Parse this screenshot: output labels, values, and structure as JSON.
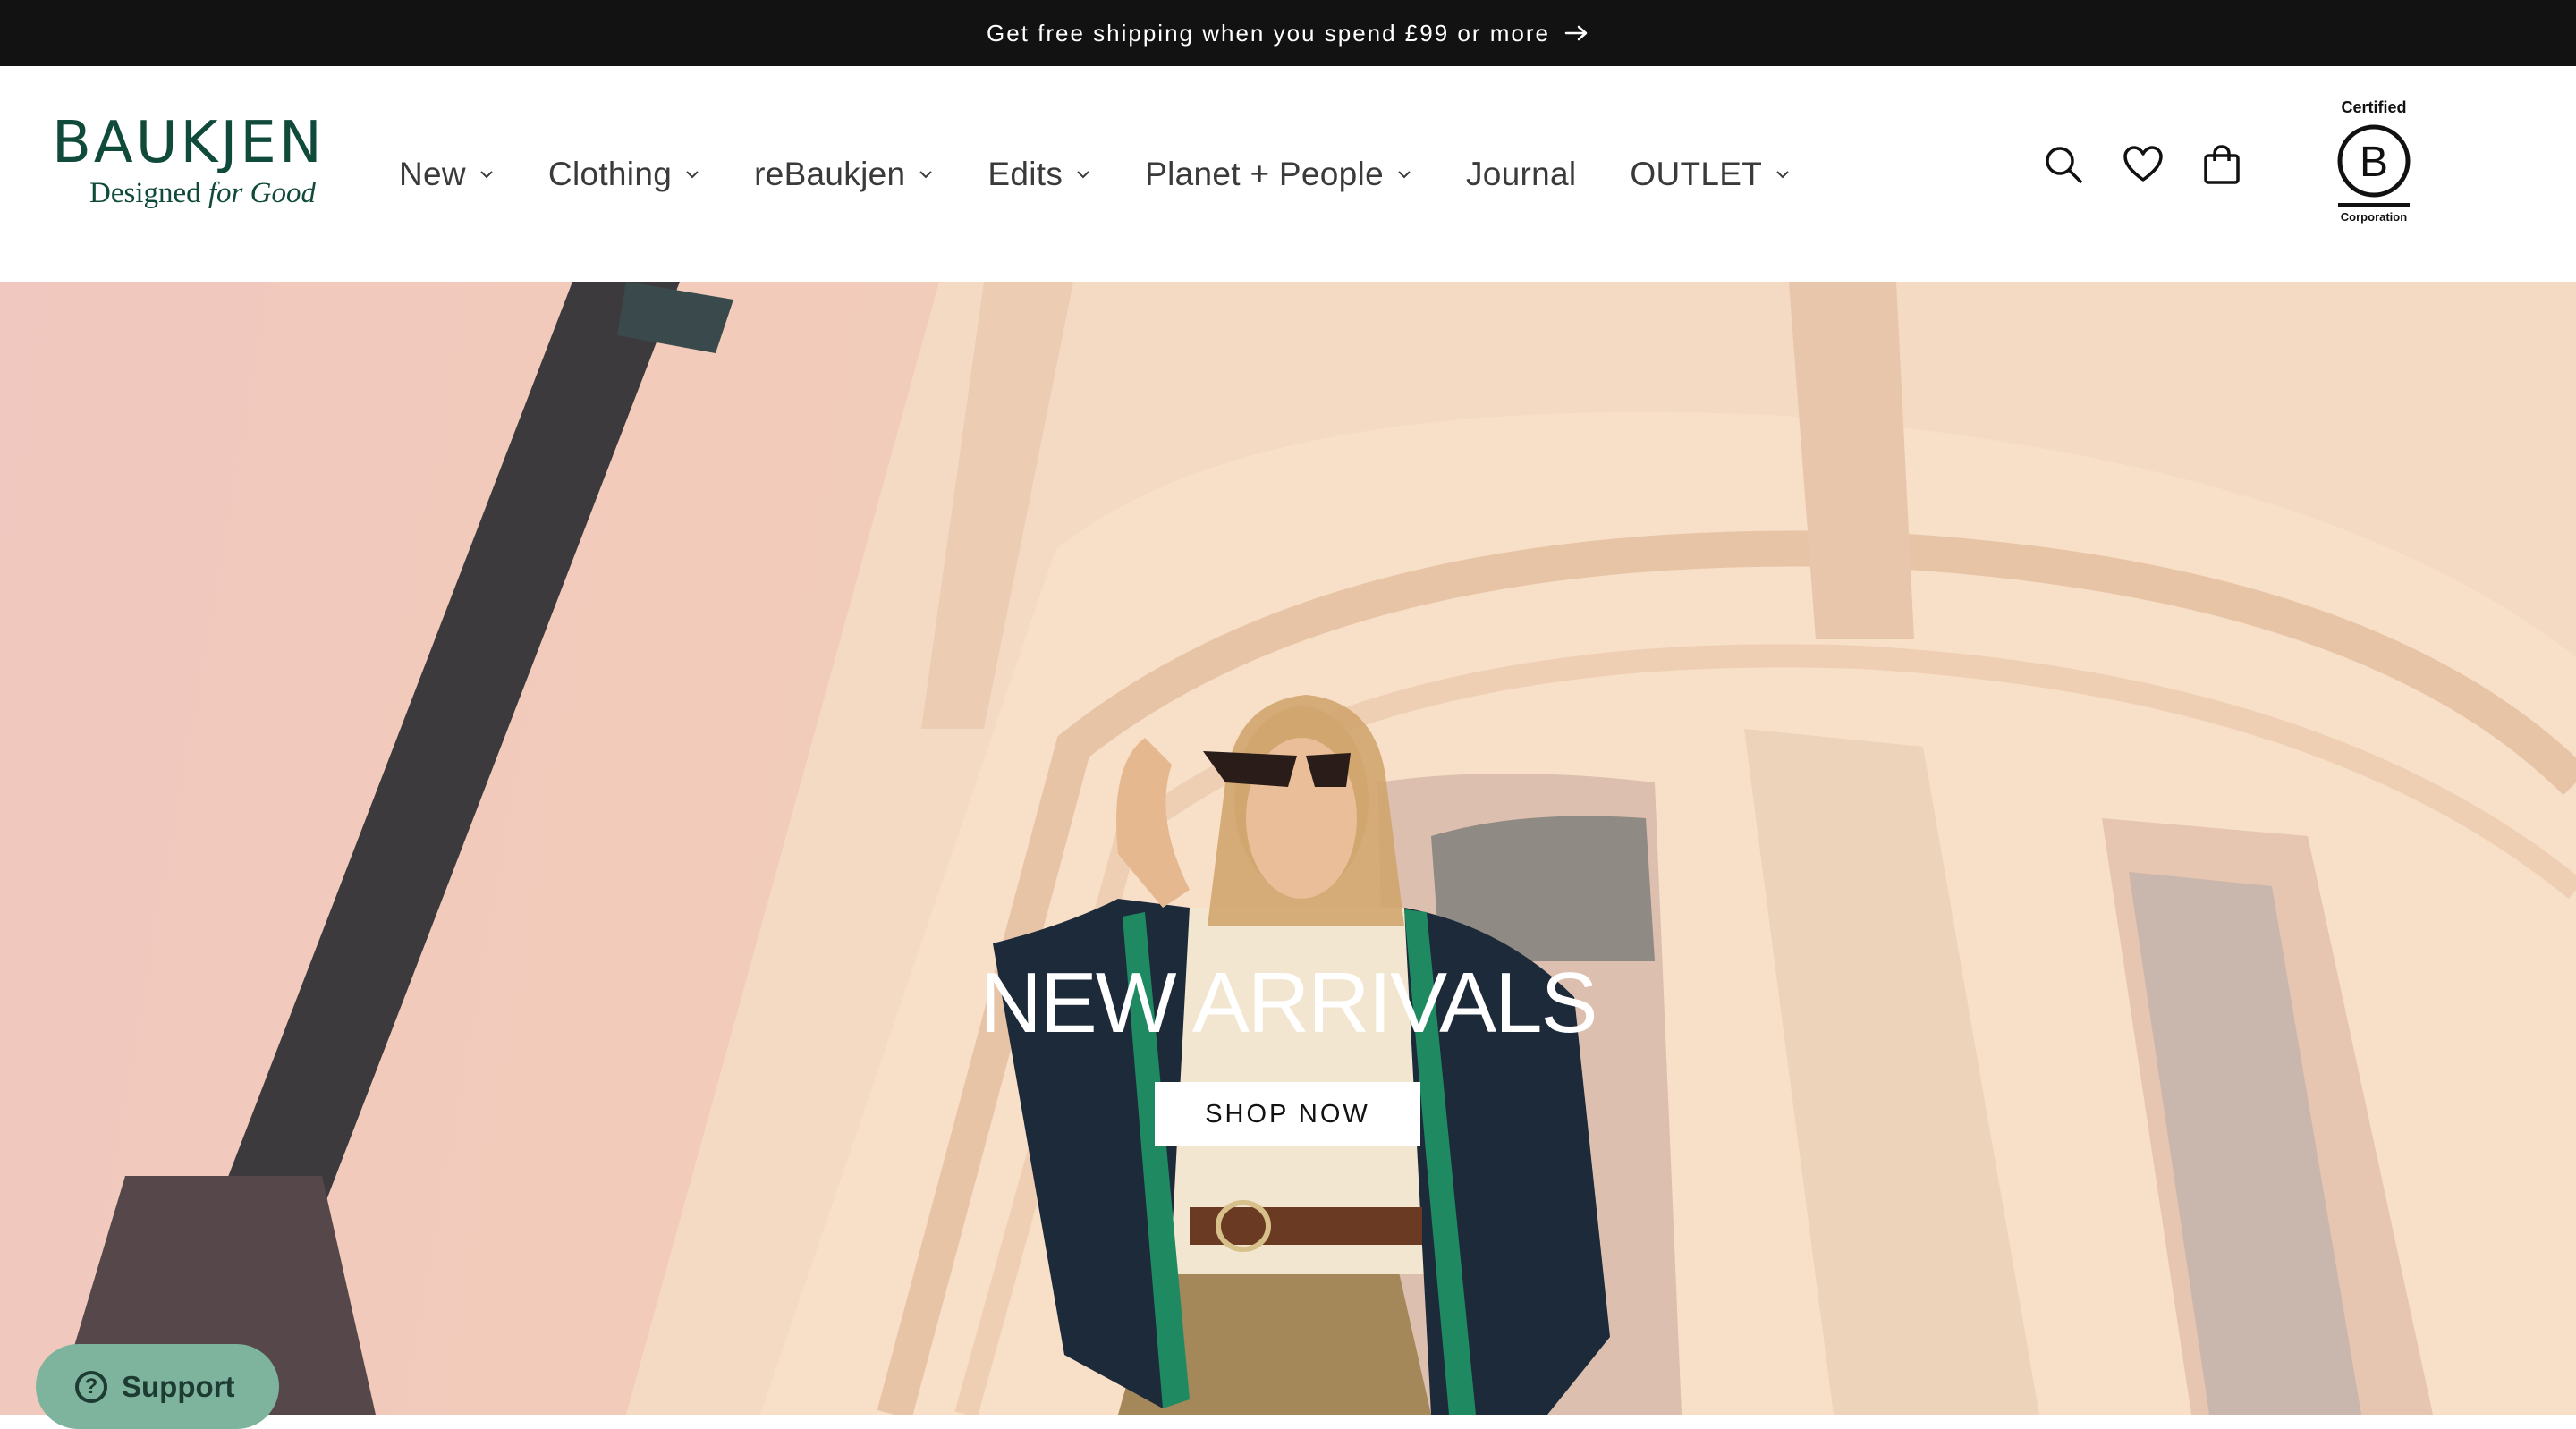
{
  "announcement": {
    "text": "Get free shipping when you spend £99 or more",
    "arrow_icon": "arrow-right-icon"
  },
  "header": {
    "logo": {
      "wordmark": "BAUKJEN",
      "tagline_prefix": "Designed ",
      "tagline_italic": "for Good",
      "color": "#0f4a3a"
    },
    "nav": [
      {
        "label": "New",
        "has_dropdown": true
      },
      {
        "label": "Clothing",
        "has_dropdown": true
      },
      {
        "label": "reBaukjen",
        "has_dropdown": true
      },
      {
        "label": "Edits",
        "has_dropdown": true
      },
      {
        "label": "Planet + People",
        "has_dropdown": true
      },
      {
        "label": "Journal",
        "has_dropdown": false
      },
      {
        "label": "OUTLET",
        "has_dropdown": true
      }
    ],
    "icons": [
      "search-icon",
      "heart-icon",
      "cart-icon"
    ],
    "bcorp": {
      "top": "Certified",
      "letter": "B",
      "bottom": "Corporation"
    }
  },
  "hero": {
    "heading": "NEW ARRIVALS",
    "cta": "SHOP NOW"
  },
  "support": {
    "label": "Support",
    "color": "#7eb39e"
  }
}
